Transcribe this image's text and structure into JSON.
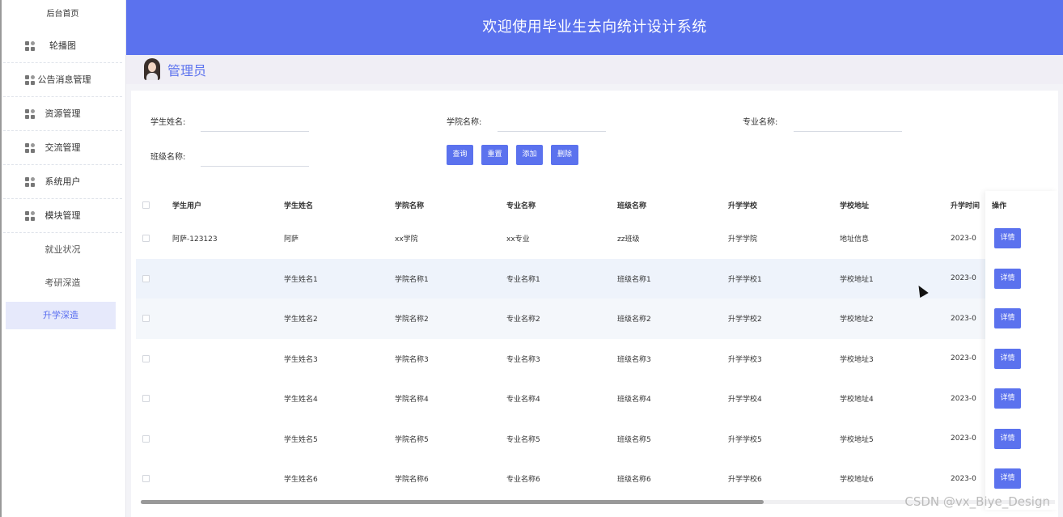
{
  "sidebar": {
    "home": "后台首页",
    "items": [
      {
        "label": "轮播图",
        "icon": "grid-icon"
      },
      {
        "label": "公告消息管理",
        "icon": "grid-icon"
      },
      {
        "label": "资源管理",
        "icon": "grid-icon"
      },
      {
        "label": "交流管理",
        "icon": "grid-icon"
      },
      {
        "label": "系统用户",
        "icon": "grid-icon"
      },
      {
        "label": "模块管理",
        "icon": "grid-icon"
      }
    ],
    "subitems": [
      {
        "label": "就业状况"
      },
      {
        "label": "考研深造"
      },
      {
        "label": "升学深造",
        "active": true
      }
    ]
  },
  "header": {
    "title": "欢迎使用毕业生去向统计设计系统"
  },
  "user": {
    "name": "管理员"
  },
  "filters": {
    "student_name_label": "学生姓名:",
    "college_name_label": "学院名称:",
    "major_name_label": "专业名称:",
    "class_name_label": "班级名称:"
  },
  "buttons": {
    "query": "查询",
    "reset": "重置",
    "add": "添加",
    "delete": "删除"
  },
  "table": {
    "columns": [
      "学生用户",
      "学生姓名",
      "学院名称",
      "专业名称",
      "班级名称",
      "升学学校",
      "学校地址",
      "升学时间",
      "操作"
    ],
    "rows": [
      [
        "阿萨-123123",
        "阿萨",
        "xx学院",
        "xx专业",
        "zz班级",
        "升学学院",
        "地址信息",
        "2023-0"
      ],
      [
        "",
        "学生姓名1",
        "学院名称1",
        "专业名称1",
        "班级名称1",
        "升学学校1",
        "学校地址1",
        "2023-0"
      ],
      [
        "",
        "学生姓名2",
        "学院名称2",
        "专业名称2",
        "班级名称2",
        "升学学校2",
        "学校地址2",
        "2023-0"
      ],
      [
        "",
        "学生姓名3",
        "学院名称3",
        "专业名称3",
        "班级名称3",
        "升学学校3",
        "学校地址3",
        "2023-0"
      ],
      [
        "",
        "学生姓名4",
        "学院名称4",
        "专业名称4",
        "班级名称4",
        "升学学校4",
        "学校地址4",
        "2023-0"
      ],
      [
        "",
        "学生姓名5",
        "学院名称5",
        "专业名称5",
        "班级名称5",
        "升学学校5",
        "学校地址5",
        "2023-0"
      ],
      [
        "",
        "学生姓名6",
        "学院名称6",
        "专业名称6",
        "班级名称6",
        "升学学校6",
        "学校地址6",
        "2023-0"
      ]
    ],
    "detail_label": "详情"
  },
  "watermark": "CSDN @vx_Biye_Design",
  "colors": {
    "accent": "#5b72ee",
    "active_bg": "#e6e9fb"
  }
}
